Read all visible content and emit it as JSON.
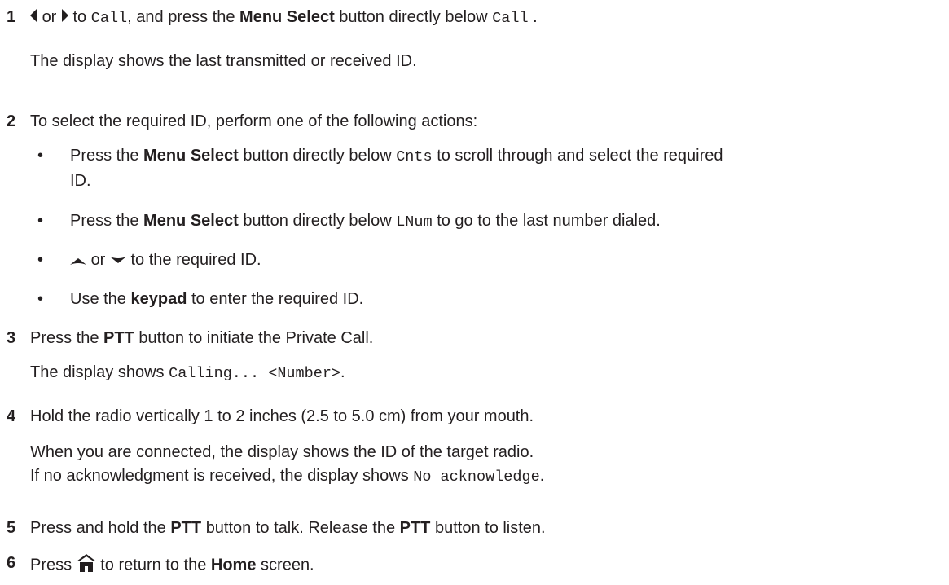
{
  "steps": [
    {
      "number": "1",
      "main": {
        "or": "or",
        "to": "to",
        "call1": "Call",
        "comma_press": ", and press the",
        "menu_select": "Menu Select",
        "directly_below": "button directly below",
        "call2": "Call",
        "end": "."
      },
      "result": "The display shows the last transmitted or received ID."
    },
    {
      "number": "2",
      "text": "To select the required ID, perform one of the following actions:",
      "bullets": [
        {
          "press": "Press the",
          "menu_select": "Menu Select",
          "below": "button directly below",
          "code": "Cnts",
          "rest": "to scroll through and select the required",
          "rest2": "ID."
        },
        {
          "press": "Press the",
          "menu_select": "Menu Select",
          "below": "button directly below",
          "code": "LNum",
          "rest": "to go to the last number dialed."
        },
        {
          "or": "or",
          "rest": "to the required ID."
        },
        {
          "use": "Use the",
          "keypad": "keypad",
          "rest": "to enter the required ID."
        }
      ]
    },
    {
      "number": "3",
      "press": "Press the",
      "ptt": "PTT",
      "rest": "button to initiate the Private Call.",
      "result_prefix": "The display shows",
      "result_code": "Calling... <Number>",
      "result_end": "."
    },
    {
      "number": "4",
      "text": "Hold the radio vertically 1 to 2 inches (2.5 to 5.0 cm) from your mouth.",
      "result1": "When you are connected, the display shows the ID of the target radio.",
      "result2_prefix": "If no acknowledgment is received, the display shows",
      "result2_code": "No acknowledge",
      "result2_end": "."
    },
    {
      "number": "5",
      "press": "Press and hold the",
      "ptt1": "PTT",
      "mid": "button to talk. Release the",
      "ptt2": "PTT",
      "rest": "button to listen."
    },
    {
      "number": "6",
      "press": "Press",
      "to": "to return to the",
      "home": "Home",
      "rest": "screen."
    }
  ],
  "icons": {
    "left": "left-arrow-icon",
    "right": "right-arrow-icon",
    "up": "up-arrow-icon",
    "down": "down-arrow-icon",
    "home": "home-icon"
  },
  "colors": {
    "text": "#231f20"
  }
}
